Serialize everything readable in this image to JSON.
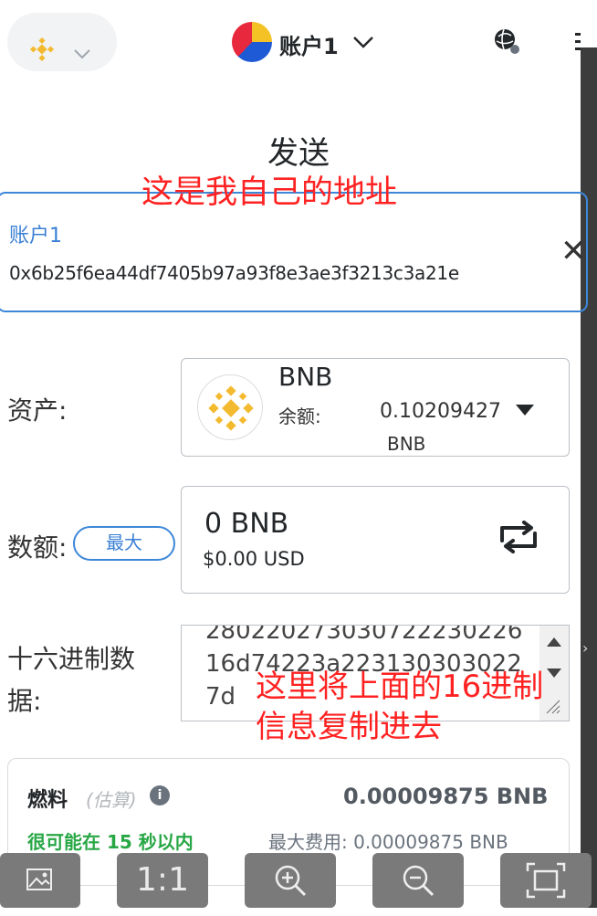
{
  "header": {
    "account_name": "账户1",
    "network_icon": "bnb-logo-icon",
    "globe_icon": "globe-icon",
    "menu_icon": "menu-icon"
  },
  "send": {
    "title": "发送",
    "recipient": {
      "name": "账户1",
      "address": "0x6b25f6ea44df7405b97a93f8e3ae3f3213c3a21e"
    },
    "asset": {
      "label": "资产:",
      "symbol": "BNB",
      "balance_label": "余额:",
      "balance_value": "0.10209427",
      "balance_unit": "BNB"
    },
    "amount": {
      "label": "数额:",
      "max_label": "最大",
      "value": "0 BNB",
      "fiat": "$0.00 USD"
    },
    "hex": {
      "label_line1": "十六进制数",
      "label_line2": "据:",
      "content": "28022027303072223022616d74223a223130303022 7d"
    },
    "fee": {
      "label": "燃料",
      "estimate_note": "(估算)",
      "info_glyph": "i",
      "value": "0.00009875 BNB",
      "time": "很可能在 15 秒以内",
      "max_fee": "最大费用: 0.00009875 BNB"
    }
  },
  "annotations": {
    "own_address": "这是我自己的地址",
    "paste_hex": "这里将上面的16进制信息复制进去"
  },
  "viewer_toolbar": {
    "zoom_ratio": "1:1"
  },
  "colors": {
    "accent": "#3d87d9",
    "annotation": "#ff2222",
    "success": "#28a745",
    "bnb": "#f3ba2f"
  }
}
